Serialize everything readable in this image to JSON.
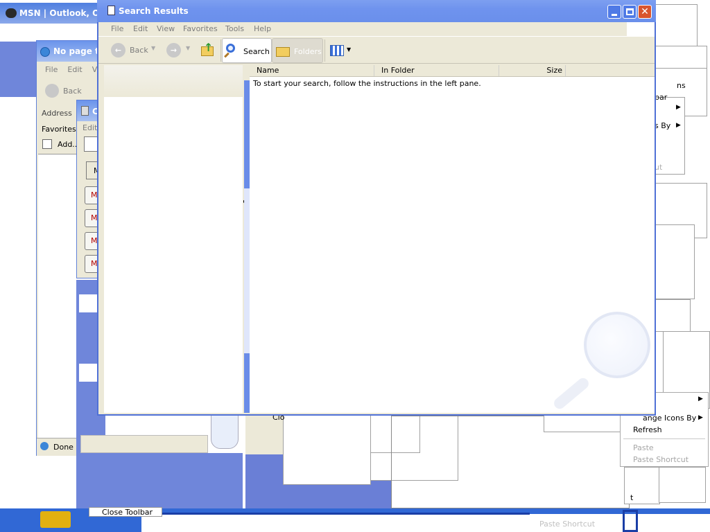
{
  "background_windows": {
    "msn_title": "MSN | Outlook, Or",
    "ie": {
      "title": "No page to",
      "menu": [
        "File",
        "Edit",
        "Vi"
      ],
      "back_label": "Back",
      "address_label": "Address",
      "favorites_label": "Favorites",
      "add_label": "Add...",
      "status": "Done"
    },
    "calculator": {
      "title": "Ca",
      "menu_edit": "Edit",
      "m_label": "M",
      "memory_buttons": [
        "MC",
        "MR",
        "MS",
        "M+"
      ]
    },
    "toolbar_menu_item": "Close Toolbar",
    "paste_shortcut_ghost": "Paste Shortcut",
    "partial_labels": {
      "ns": "ns",
      "bar": "bar",
      "s_by": "s By",
      "ut": "ut",
      "clo": "Clo",
      "t": "t"
    }
  },
  "context_menu": {
    "arrange": "ange Icons By",
    "refresh": "Refresh",
    "paste": "Paste",
    "paste_shortcut": "Paste Shortcut"
  },
  "search_window": {
    "title": "Search Results",
    "menu": [
      "File",
      "Edit",
      "View",
      "Favorites",
      "Tools",
      "Help"
    ],
    "toolbar": {
      "back": "Back",
      "search": "Search",
      "folders": "Folders"
    },
    "columns": [
      "Name",
      "In Folder",
      "Size"
    ],
    "message": "To start your search, follow the instructions in the left pane."
  },
  "colors": {
    "xp_title_blue": "#4a7ee6",
    "desktop_blue": "#6f86da",
    "taskbar_blue": "#3168d5"
  }
}
